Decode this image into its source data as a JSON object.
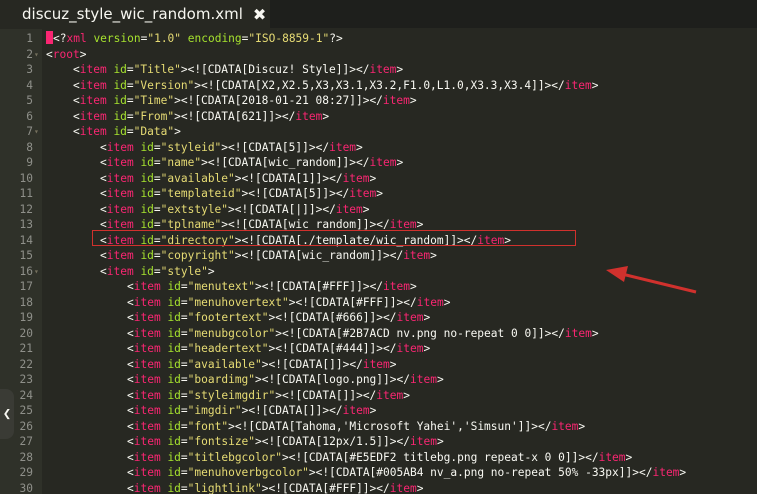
{
  "tab": {
    "title": "discuz_style_wic_random.xml",
    "close_icon": "✖"
  },
  "colors": {
    "tag": "#f92672",
    "attr": "#a6e22e",
    "string": "#e6db74",
    "text": "#f8f8f2",
    "highlight_border": "#d0312d"
  },
  "lines": [
    {
      "n": "1",
      "fold": "",
      "indent": 0,
      "parts": [
        [
          "cursor",
          ""
        ],
        [
          "p",
          "<?"
        ],
        [
          "t",
          "xml"
        ],
        [
          "a",
          " version"
        ],
        [
          "p",
          "="
        ],
        [
          "s",
          "\"1.0\""
        ],
        [
          "a",
          " encoding"
        ],
        [
          "p",
          "="
        ],
        [
          "s",
          "\"ISO-8859-1\""
        ],
        [
          "p",
          "?>"
        ]
      ]
    },
    {
      "n": "2",
      "fold": "▾",
      "indent": 0,
      "parts": [
        [
          "p",
          "<"
        ],
        [
          "t",
          "root"
        ],
        [
          "p",
          ">"
        ]
      ]
    },
    {
      "n": "3",
      "fold": "",
      "indent": 1,
      "parts": [
        [
          "p",
          "<"
        ],
        [
          "t",
          "item"
        ],
        [
          "a",
          " id"
        ],
        [
          "p",
          "="
        ],
        [
          "s",
          "\"Title\""
        ],
        [
          "p",
          ">"
        ],
        [
          "c",
          "<![CDATA[Discuz! Style]]>"
        ],
        [
          "p",
          "</"
        ],
        [
          "t",
          "item"
        ],
        [
          "p",
          ">"
        ]
      ]
    },
    {
      "n": "4",
      "fold": "",
      "indent": 1,
      "parts": [
        [
          "p",
          "<"
        ],
        [
          "t",
          "item"
        ],
        [
          "a",
          " id"
        ],
        [
          "p",
          "="
        ],
        [
          "s",
          "\"Version\""
        ],
        [
          "p",
          ">"
        ],
        [
          "c",
          "<![CDATA[X2,X2.5,X3,X3.1,X3.2,F1.0,L1.0,X3.3,X3.4]]>"
        ],
        [
          "p",
          "</"
        ],
        [
          "t",
          "item"
        ],
        [
          "p",
          ">"
        ]
      ]
    },
    {
      "n": "5",
      "fold": "",
      "indent": 1,
      "parts": [
        [
          "p",
          "<"
        ],
        [
          "t",
          "item"
        ],
        [
          "a",
          " id"
        ],
        [
          "p",
          "="
        ],
        [
          "s",
          "\"Time\""
        ],
        [
          "p",
          ">"
        ],
        [
          "c",
          "<![CDATA[2018-01-21 08:27]]>"
        ],
        [
          "p",
          "</"
        ],
        [
          "t",
          "item"
        ],
        [
          "p",
          ">"
        ]
      ]
    },
    {
      "n": "6",
      "fold": "",
      "indent": 1,
      "parts": [
        [
          "p",
          "<"
        ],
        [
          "t",
          "item"
        ],
        [
          "a",
          " id"
        ],
        [
          "p",
          "="
        ],
        [
          "s",
          "\"From\""
        ],
        [
          "p",
          ">"
        ],
        [
          "c",
          "<![CDATA[621]]>"
        ],
        [
          "p",
          "</"
        ],
        [
          "t",
          "item"
        ],
        [
          "p",
          ">"
        ]
      ]
    },
    {
      "n": "7",
      "fold": "▾",
      "indent": 1,
      "parts": [
        [
          "p",
          "<"
        ],
        [
          "t",
          "item"
        ],
        [
          "a",
          " id"
        ],
        [
          "p",
          "="
        ],
        [
          "s",
          "\"Data\""
        ],
        [
          "p",
          ">"
        ]
      ]
    },
    {
      "n": "8",
      "fold": "",
      "indent": 2,
      "parts": [
        [
          "p",
          "<"
        ],
        [
          "t",
          "item"
        ],
        [
          "a",
          " id"
        ],
        [
          "p",
          "="
        ],
        [
          "s",
          "\"styleid\""
        ],
        [
          "p",
          ">"
        ],
        [
          "c",
          "<![CDATA[5]]>"
        ],
        [
          "p",
          "</"
        ],
        [
          "t",
          "item"
        ],
        [
          "p",
          ">"
        ]
      ]
    },
    {
      "n": "9",
      "fold": "",
      "indent": 2,
      "parts": [
        [
          "p",
          "<"
        ],
        [
          "t",
          "item"
        ],
        [
          "a",
          " id"
        ],
        [
          "p",
          "="
        ],
        [
          "s",
          "\"name\""
        ],
        [
          "p",
          ">"
        ],
        [
          "c",
          "<![CDATA[wic_random]]>"
        ],
        [
          "p",
          "</"
        ],
        [
          "t",
          "item"
        ],
        [
          "p",
          ">"
        ]
      ]
    },
    {
      "n": "10",
      "fold": "",
      "indent": 2,
      "parts": [
        [
          "p",
          "<"
        ],
        [
          "t",
          "item"
        ],
        [
          "a",
          " id"
        ],
        [
          "p",
          "="
        ],
        [
          "s",
          "\"available\""
        ],
        [
          "p",
          ">"
        ],
        [
          "c",
          "<![CDATA[1]]>"
        ],
        [
          "p",
          "</"
        ],
        [
          "t",
          "item"
        ],
        [
          "p",
          ">"
        ]
      ]
    },
    {
      "n": "11",
      "fold": "",
      "indent": 2,
      "parts": [
        [
          "p",
          "<"
        ],
        [
          "t",
          "item"
        ],
        [
          "a",
          " id"
        ],
        [
          "p",
          "="
        ],
        [
          "s",
          "\"templateid\""
        ],
        [
          "p",
          ">"
        ],
        [
          "c",
          "<![CDATA[5]]>"
        ],
        [
          "p",
          "</"
        ],
        [
          "t",
          "item"
        ],
        [
          "p",
          ">"
        ]
      ]
    },
    {
      "n": "12",
      "fold": "",
      "indent": 2,
      "parts": [
        [
          "p",
          "<"
        ],
        [
          "t",
          "item"
        ],
        [
          "a",
          " id"
        ],
        [
          "p",
          "="
        ],
        [
          "s",
          "\"extstyle\""
        ],
        [
          "p",
          ">"
        ],
        [
          "c",
          "<![CDATA[|]]>"
        ],
        [
          "p",
          "</"
        ],
        [
          "t",
          "item"
        ],
        [
          "p",
          ">"
        ]
      ]
    },
    {
      "n": "13",
      "fold": "",
      "indent": 2,
      "parts": [
        [
          "p",
          "<"
        ],
        [
          "t",
          "item"
        ],
        [
          "a",
          " id"
        ],
        [
          "p",
          "="
        ],
        [
          "s",
          "\"tplname\""
        ],
        [
          "p",
          ">"
        ],
        [
          "c",
          "<![CDATA[wic_random]]>"
        ],
        [
          "p",
          "</"
        ],
        [
          "t",
          "item"
        ],
        [
          "p",
          ">"
        ]
      ]
    },
    {
      "n": "14",
      "fold": "",
      "indent": 2,
      "parts": [
        [
          "p",
          "<"
        ],
        [
          "t",
          "item"
        ],
        [
          "a",
          " id"
        ],
        [
          "p",
          "="
        ],
        [
          "s",
          "\"directory\""
        ],
        [
          "p",
          ">"
        ],
        [
          "c",
          "<![CDATA[./template/wic_random]]>"
        ],
        [
          "p",
          "</"
        ],
        [
          "t",
          "item"
        ],
        [
          "p",
          ">"
        ]
      ]
    },
    {
      "n": "15",
      "fold": "",
      "indent": 2,
      "parts": [
        [
          "p",
          "<"
        ],
        [
          "t",
          "item"
        ],
        [
          "a",
          " id"
        ],
        [
          "p",
          "="
        ],
        [
          "s",
          "\"copyright\""
        ],
        [
          "p",
          ">"
        ],
        [
          "c",
          "<![CDATA[wic_random]]>"
        ],
        [
          "p",
          "</"
        ],
        [
          "t",
          "item"
        ],
        [
          "p",
          ">"
        ]
      ]
    },
    {
      "n": "16",
      "fold": "▾",
      "indent": 2,
      "parts": [
        [
          "p",
          "<"
        ],
        [
          "t",
          "item"
        ],
        [
          "a",
          " id"
        ],
        [
          "p",
          "="
        ],
        [
          "s",
          "\"style\""
        ],
        [
          "p",
          ">"
        ]
      ]
    },
    {
      "n": "17",
      "fold": "",
      "indent": 3,
      "parts": [
        [
          "p",
          "<"
        ],
        [
          "t",
          "item"
        ],
        [
          "a",
          " id"
        ],
        [
          "p",
          "="
        ],
        [
          "s",
          "\"menutext\""
        ],
        [
          "p",
          ">"
        ],
        [
          "c",
          "<![CDATA[#FFF]]>"
        ],
        [
          "p",
          "</"
        ],
        [
          "t",
          "item"
        ],
        [
          "p",
          ">"
        ]
      ]
    },
    {
      "n": "18",
      "fold": "",
      "indent": 3,
      "parts": [
        [
          "p",
          "<"
        ],
        [
          "t",
          "item"
        ],
        [
          "a",
          " id"
        ],
        [
          "p",
          "="
        ],
        [
          "s",
          "\"menuhovertext\""
        ],
        [
          "p",
          ">"
        ],
        [
          "c",
          "<![CDATA[#FFF]]>"
        ],
        [
          "p",
          "</"
        ],
        [
          "t",
          "item"
        ],
        [
          "p",
          ">"
        ]
      ]
    },
    {
      "n": "19",
      "fold": "",
      "indent": 3,
      "parts": [
        [
          "p",
          "<"
        ],
        [
          "t",
          "item"
        ],
        [
          "a",
          " id"
        ],
        [
          "p",
          "="
        ],
        [
          "s",
          "\"footertext\""
        ],
        [
          "p",
          ">"
        ],
        [
          "c",
          "<![CDATA[#666]]>"
        ],
        [
          "p",
          "</"
        ],
        [
          "t",
          "item"
        ],
        [
          "p",
          ">"
        ]
      ]
    },
    {
      "n": "20",
      "fold": "",
      "indent": 3,
      "parts": [
        [
          "p",
          "<"
        ],
        [
          "t",
          "item"
        ],
        [
          "a",
          " id"
        ],
        [
          "p",
          "="
        ],
        [
          "s",
          "\"menubgcolor\""
        ],
        [
          "p",
          ">"
        ],
        [
          "c",
          "<![CDATA[#2B7ACD nv.png no-repeat 0 0]]>"
        ],
        [
          "p",
          "</"
        ],
        [
          "t",
          "item"
        ],
        [
          "p",
          ">"
        ]
      ]
    },
    {
      "n": "21",
      "fold": "",
      "indent": 3,
      "parts": [
        [
          "p",
          "<"
        ],
        [
          "t",
          "item"
        ],
        [
          "a",
          " id"
        ],
        [
          "p",
          "="
        ],
        [
          "s",
          "\"headertext\""
        ],
        [
          "p",
          ">"
        ],
        [
          "c",
          "<![CDATA[#444]]>"
        ],
        [
          "p",
          "</"
        ],
        [
          "t",
          "item"
        ],
        [
          "p",
          ">"
        ]
      ]
    },
    {
      "n": "22",
      "fold": "",
      "indent": 3,
      "parts": [
        [
          "p",
          "<"
        ],
        [
          "t",
          "item"
        ],
        [
          "a",
          " id"
        ],
        [
          "p",
          "="
        ],
        [
          "s",
          "\"available\""
        ],
        [
          "p",
          ">"
        ],
        [
          "c",
          "<![CDATA[]]>"
        ],
        [
          "p",
          "</"
        ],
        [
          "t",
          "item"
        ],
        [
          "p",
          ">"
        ]
      ]
    },
    {
      "n": "23",
      "fold": "",
      "indent": 3,
      "parts": [
        [
          "p",
          "<"
        ],
        [
          "t",
          "item"
        ],
        [
          "a",
          " id"
        ],
        [
          "p",
          "="
        ],
        [
          "s",
          "\"boardimg\""
        ],
        [
          "p",
          ">"
        ],
        [
          "c",
          "<![CDATA[logo.png]]>"
        ],
        [
          "p",
          "</"
        ],
        [
          "t",
          "item"
        ],
        [
          "p",
          ">"
        ]
      ]
    },
    {
      "n": "24",
      "fold": "",
      "indent": 3,
      "parts": [
        [
          "p",
          "<"
        ],
        [
          "t",
          "item"
        ],
        [
          "a",
          " id"
        ],
        [
          "p",
          "="
        ],
        [
          "s",
          "\"styleimgdir\""
        ],
        [
          "p",
          ">"
        ],
        [
          "c",
          "<![CDATA[]]>"
        ],
        [
          "p",
          "</"
        ],
        [
          "t",
          "item"
        ],
        [
          "p",
          ">"
        ]
      ]
    },
    {
      "n": "25",
      "fold": "",
      "indent": 3,
      "parts": [
        [
          "p",
          "<"
        ],
        [
          "t",
          "item"
        ],
        [
          "a",
          " id"
        ],
        [
          "p",
          "="
        ],
        [
          "s",
          "\"imgdir\""
        ],
        [
          "p",
          ">"
        ],
        [
          "c",
          "<![CDATA[]]>"
        ],
        [
          "p",
          "</"
        ],
        [
          "t",
          "item"
        ],
        [
          "p",
          ">"
        ]
      ]
    },
    {
      "n": "26",
      "fold": "",
      "indent": 3,
      "parts": [
        [
          "p",
          "<"
        ],
        [
          "t",
          "item"
        ],
        [
          "a",
          " id"
        ],
        [
          "p",
          "="
        ],
        [
          "s",
          "\"font\""
        ],
        [
          "p",
          ">"
        ],
        [
          "c",
          "<![CDATA[Tahoma,'Microsoft Yahei','Simsun']]>"
        ],
        [
          "p",
          "</"
        ],
        [
          "t",
          "item"
        ],
        [
          "p",
          ">"
        ]
      ]
    },
    {
      "n": "27",
      "fold": "",
      "indent": 3,
      "parts": [
        [
          "p",
          "<"
        ],
        [
          "t",
          "item"
        ],
        [
          "a",
          " id"
        ],
        [
          "p",
          "="
        ],
        [
          "s",
          "\"fontsize\""
        ],
        [
          "p",
          ">"
        ],
        [
          "c",
          "<![CDATA[12px/1.5]]>"
        ],
        [
          "p",
          "</"
        ],
        [
          "t",
          "item"
        ],
        [
          "p",
          ">"
        ]
      ]
    },
    {
      "n": "28",
      "fold": "",
      "indent": 3,
      "parts": [
        [
          "p",
          "<"
        ],
        [
          "t",
          "item"
        ],
        [
          "a",
          " id"
        ],
        [
          "p",
          "="
        ],
        [
          "s",
          "\"titlebgcolor\""
        ],
        [
          "p",
          ">"
        ],
        [
          "c",
          "<![CDATA[#E5EDF2 titlebg.png repeat-x 0 0]]>"
        ],
        [
          "p",
          "</"
        ],
        [
          "t",
          "item"
        ],
        [
          "p",
          ">"
        ]
      ]
    },
    {
      "n": "29",
      "fold": "",
      "indent": 3,
      "parts": [
        [
          "p",
          "<"
        ],
        [
          "t",
          "item"
        ],
        [
          "a",
          " id"
        ],
        [
          "p",
          "="
        ],
        [
          "s",
          "\"menuhoverbgcolor\""
        ],
        [
          "p",
          ">"
        ],
        [
          "c",
          "<![CDATA[#005AB4 nv_a.png no-repeat 50% -33px]]>"
        ],
        [
          "p",
          "</"
        ],
        [
          "t",
          "item"
        ],
        [
          "p",
          ">"
        ]
      ]
    },
    {
      "n": "30",
      "fold": "",
      "indent": 3,
      "parts": [
        [
          "p",
          "<"
        ],
        [
          "t",
          "item"
        ],
        [
          "a",
          " id"
        ],
        [
          "p",
          "="
        ],
        [
          "s",
          "\"lightlink\""
        ],
        [
          "p",
          ">"
        ],
        [
          "c",
          "<![CDATA[#FFF]]>"
        ],
        [
          "p",
          "</"
        ],
        [
          "t",
          "item"
        ],
        [
          "p",
          ">"
        ]
      ]
    }
  ],
  "scroll_left_icon": "❮"
}
